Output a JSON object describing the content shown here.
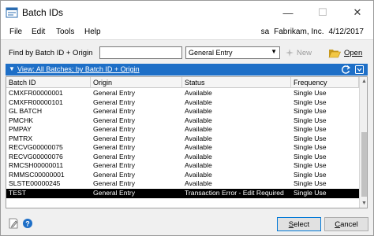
{
  "window": {
    "title": "Batch IDs",
    "controls": {
      "minimize": "—",
      "maximize": "☐",
      "close": "✕"
    }
  },
  "menu": {
    "items": [
      "File",
      "Edit",
      "Tools",
      "Help"
    ],
    "user": "sa",
    "company": "Fabrikam, Inc.",
    "date": "4/12/2017"
  },
  "find": {
    "label": "Find by Batch ID + Origin",
    "input_value": "",
    "origin_selected": "General Entry",
    "new_label": "New",
    "open_label": "Open"
  },
  "view": {
    "label": "View: All Batches; by Batch ID + Origin"
  },
  "grid": {
    "columns": [
      "Batch ID",
      "Origin",
      "Status",
      "Frequency"
    ],
    "rows": [
      [
        "CMXFR00000001",
        "General Entry",
        "Available",
        "Single Use"
      ],
      [
        "CMXFR00000101",
        "General Entry",
        "Available",
        "Single Use"
      ],
      [
        "GL BATCH",
        "General Entry",
        "Available",
        "Single Use"
      ],
      [
        "PMCHK",
        "General Entry",
        "Available",
        "Single Use"
      ],
      [
        "PMPAY",
        "General Entry",
        "Available",
        "Single Use"
      ],
      [
        "PMTRX",
        "General Entry",
        "Available",
        "Single Use"
      ],
      [
        "RECVG00000075",
        "General Entry",
        "Available",
        "Single Use"
      ],
      [
        "RECVG00000076",
        "General Entry",
        "Available",
        "Single Use"
      ],
      [
        "RMCSH00000011",
        "General Entry",
        "Available",
        "Single Use"
      ],
      [
        "RMMSC00000001",
        "General Entry",
        "Available",
        "Single Use"
      ],
      [
        "SLSTE00000245",
        "General Entry",
        "Available",
        "Single Use"
      ],
      [
        "TEST",
        "General Entry",
        "Transaction Error - Edit Required",
        "Single Use"
      ]
    ],
    "selected_row": 11
  },
  "buttons": {
    "select": "Select",
    "cancel": "Cancel"
  },
  "colors": {
    "viewbar": "#1e6fc7",
    "selected_row_bg": "#000000",
    "selected_row_fg": "#ffffff"
  }
}
